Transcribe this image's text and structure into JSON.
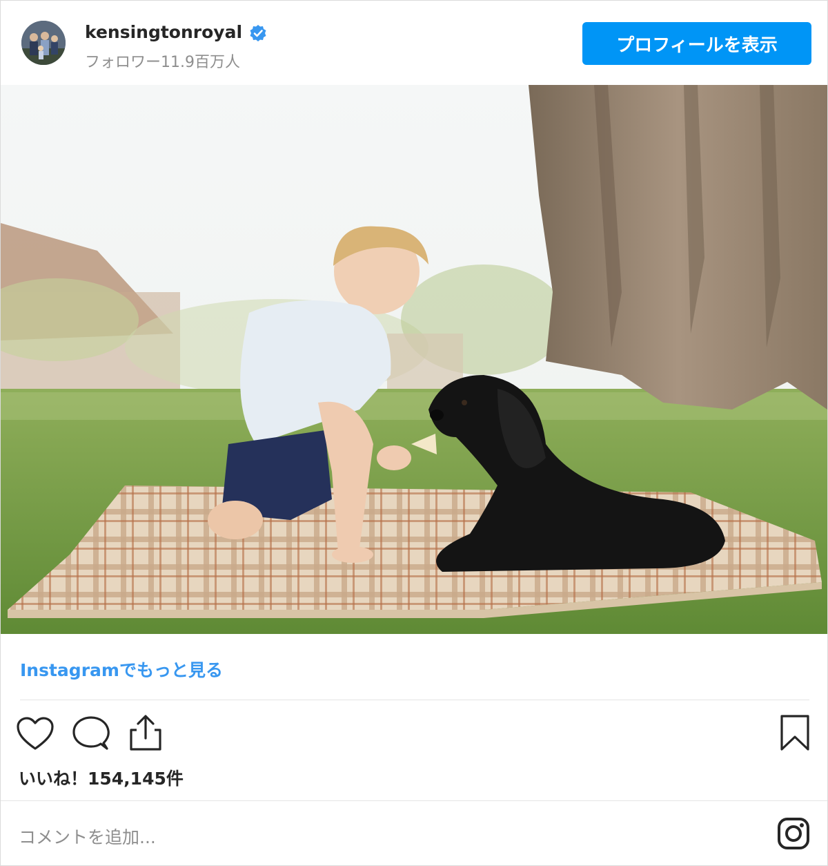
{
  "header": {
    "username": "kensingtonroyal",
    "followers": "フォロワー11.9百万人",
    "profile_button": "プロフィールを表示"
  },
  "post": {
    "more_link": "Instagramでもっと見る",
    "likes": "いいね！154,145件",
    "comment_placeholder": "コメントを追加..."
  },
  "icons": [
    "verified-icon",
    "heart-icon",
    "comment-icon",
    "share-icon",
    "bookmark-icon",
    "instagram-icon"
  ],
  "colors": {
    "accent": "#0095f6",
    "link": "#3897f0",
    "muted": "#8e8e8e",
    "text": "#262626"
  }
}
